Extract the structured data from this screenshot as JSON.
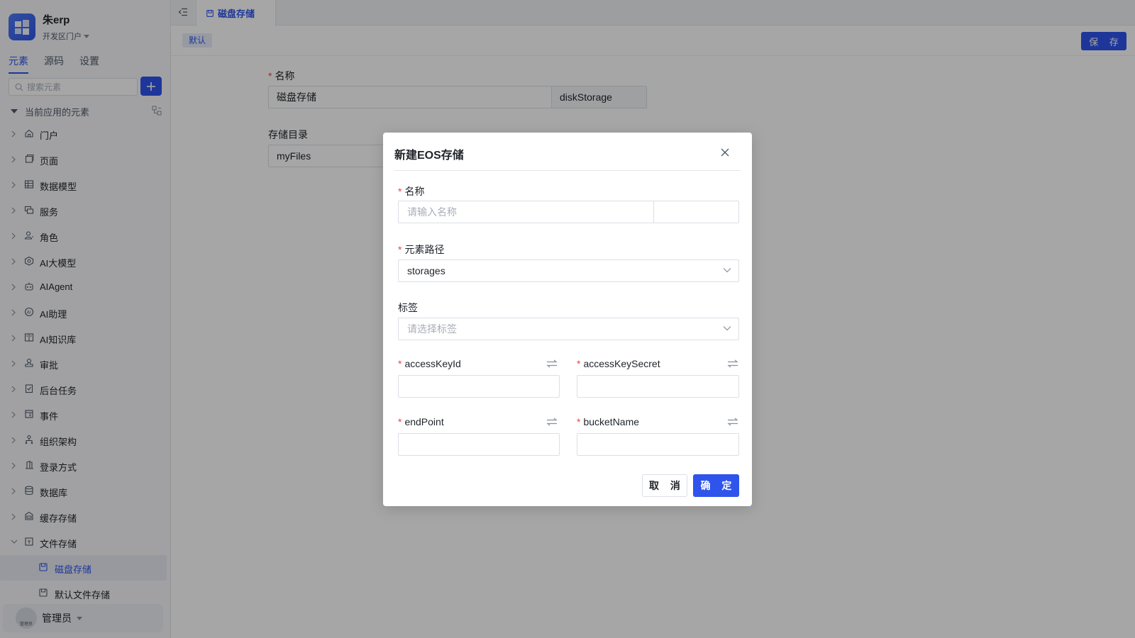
{
  "app": {
    "name": "朱erp",
    "portal": "开发区门户"
  },
  "sidebar": {
    "tabs": [
      {
        "label": "元素",
        "active": true
      },
      {
        "label": "源码",
        "active": false
      },
      {
        "label": "设置",
        "active": false
      }
    ],
    "search_placeholder": "搜索元素",
    "root_label": "当前应用的元素",
    "items": [
      {
        "label": "门户",
        "icon": "home-icon"
      },
      {
        "label": "页面",
        "icon": "page-icon"
      },
      {
        "label": "数据模型",
        "icon": "table-icon"
      },
      {
        "label": "服务",
        "icon": "service-icon"
      },
      {
        "label": "角色",
        "icon": "role-icon"
      },
      {
        "label": "AI大模型",
        "icon": "cube-icon"
      },
      {
        "label": "AIAgent",
        "icon": "robot-icon"
      },
      {
        "label": "AI助理",
        "icon": "ai-icon"
      },
      {
        "label": "AI知识库",
        "icon": "book-icon"
      },
      {
        "label": "审批",
        "icon": "approval-icon"
      },
      {
        "label": "后台任务",
        "icon": "task-icon"
      },
      {
        "label": "事件",
        "icon": "event-icon"
      },
      {
        "label": "组织架构",
        "icon": "org-icon"
      },
      {
        "label": "登录方式",
        "icon": "login-icon"
      },
      {
        "label": "数据库",
        "icon": "database-icon"
      },
      {
        "label": "缓存存储",
        "icon": "cache-icon"
      },
      {
        "label": "文件存储",
        "icon": "folder-icon"
      }
    ],
    "children": [
      {
        "label": "磁盘存储",
        "icon": "disk-icon",
        "selected": true
      },
      {
        "label": "默认文件存储",
        "icon": "disk-icon",
        "selected": false
      }
    ],
    "user": {
      "name": "管理员",
      "avatar_text": "管理员"
    }
  },
  "main": {
    "tab_label": "磁盘存储",
    "default_tag": "默认",
    "save_label": "保 存",
    "form": {
      "name_label": "名称",
      "name_value": "磁盘存储",
      "name_code": "diskStorage",
      "dir_label": "存储目录",
      "dir_value": "myFiles"
    }
  },
  "modal": {
    "title": "新建EOS存储",
    "name_label": "名称",
    "name_placeholder": "请输入名称",
    "path_label": "元素路径",
    "path_value": "storages",
    "tag_label": "标签",
    "tag_placeholder": "请选择标签",
    "access_key_id_label": "accessKeyId",
    "access_key_secret_label": "accessKeySecret",
    "endpoint_label": "endPoint",
    "bucket_name_label": "bucketName",
    "cancel_label": "取 消",
    "ok_label": "确 定"
  },
  "colors": {
    "primary": "#2f54eb",
    "required": "#f53f3f"
  }
}
